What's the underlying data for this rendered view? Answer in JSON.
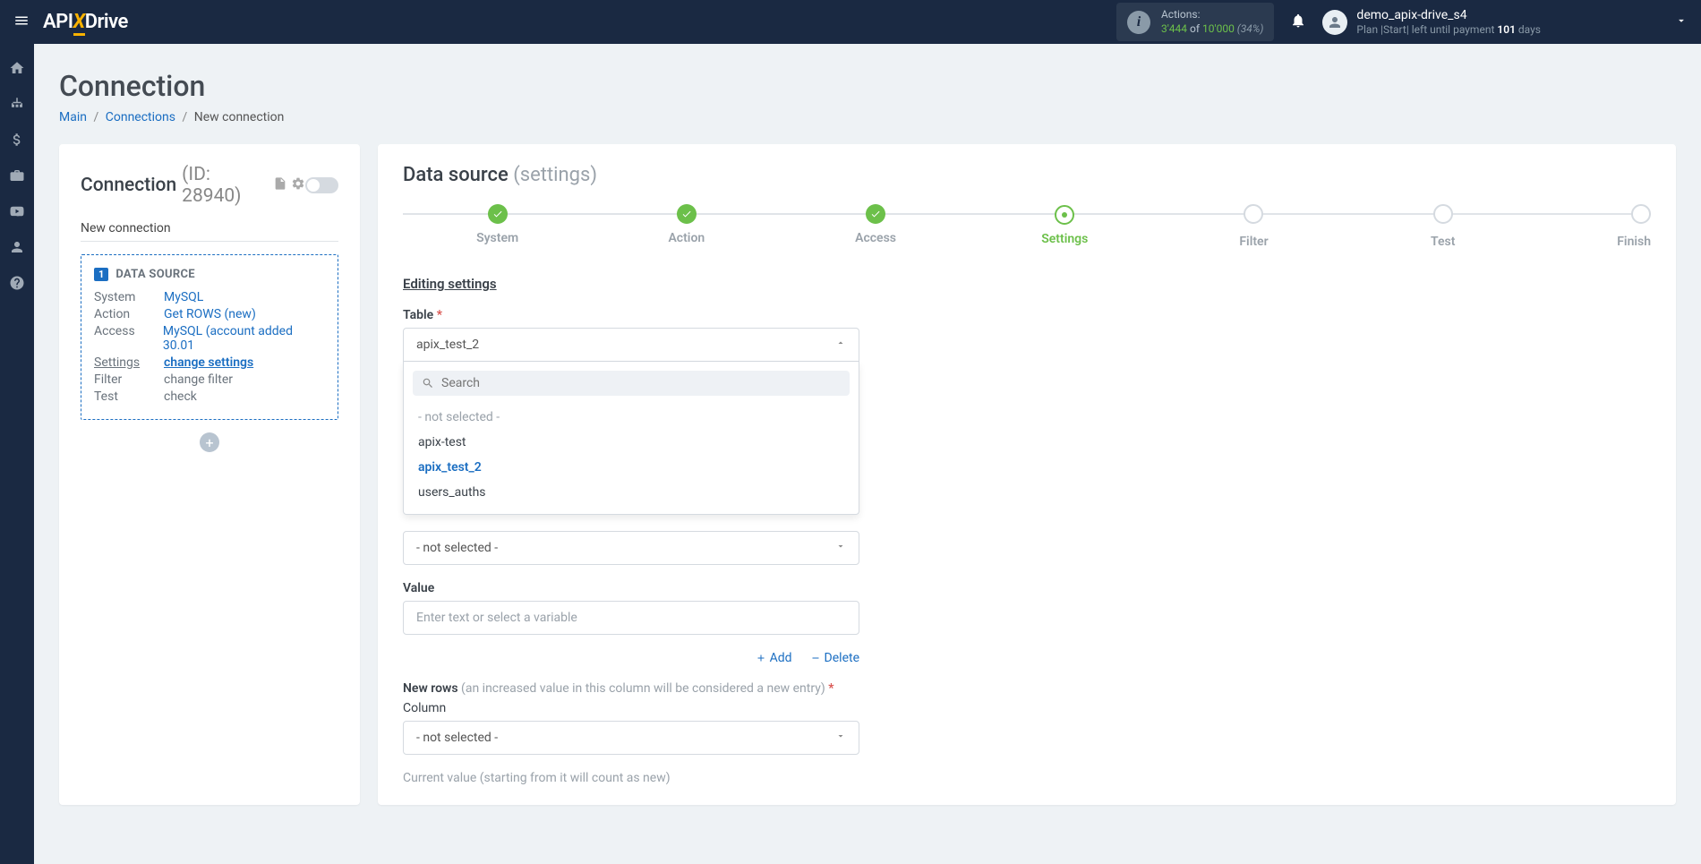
{
  "header": {
    "brand_pre": "API",
    "brand_x": "X",
    "brand_post": "Drive",
    "actions_label": "Actions:",
    "actions_current": "3'444",
    "actions_of": " of ",
    "actions_max": "10'000",
    "actions_pct": " (34%)",
    "username": "demo_apix-drive_s4",
    "plan_pre": "Plan |Start| left until payment ",
    "plan_days": "101",
    "plan_post": " days"
  },
  "page": {
    "title": "Connection",
    "breadcrumb": {
      "main": "Main",
      "connections": "Connections",
      "current": "New connection"
    }
  },
  "left": {
    "title": "Connection ",
    "id": "(ID: 28940)",
    "subtitle": "New connection",
    "ds_badge": "1",
    "ds_title": "DATA SOURCE",
    "rows": {
      "system": {
        "label": "System",
        "value": "MySQL"
      },
      "action": {
        "label": "Action",
        "value": "Get ROWS (new)"
      },
      "access": {
        "label": "Access",
        "value": "MySQL (account added 30.01"
      },
      "settings": {
        "label": "Settings",
        "value": "change settings"
      },
      "filter": {
        "label": "Filter",
        "value": "change filter"
      },
      "test": {
        "label": "Test",
        "value": "check"
      }
    }
  },
  "right": {
    "title": "Data source ",
    "title_sub": "(settings)",
    "steps": {
      "system": "System",
      "action": "Action",
      "access": "Access",
      "settings": "Settings",
      "filter": "Filter",
      "test": "Test",
      "finish": "Finish"
    },
    "section": "Editing settings",
    "table_label": "Table ",
    "table_value": "apix_test_2",
    "search_placeholder": "Search",
    "dd_not_selected": "- not selected -",
    "dd_opt1": "apix-test",
    "dd_opt2": "apix_test_2",
    "dd_opt3": "users_auths",
    "column_select": "- not selected -",
    "value_label": "Value",
    "value_placeholder": "Enter text or select a variable",
    "add": "Add",
    "delete": "Delete",
    "newrows_label": "New rows ",
    "newrows_hint": "(an increased value in this column will be considered a new entry) ",
    "column_label": "Column",
    "column2_select": "- not selected -",
    "current_value_hint": "Current value (starting from it will count as new)"
  }
}
